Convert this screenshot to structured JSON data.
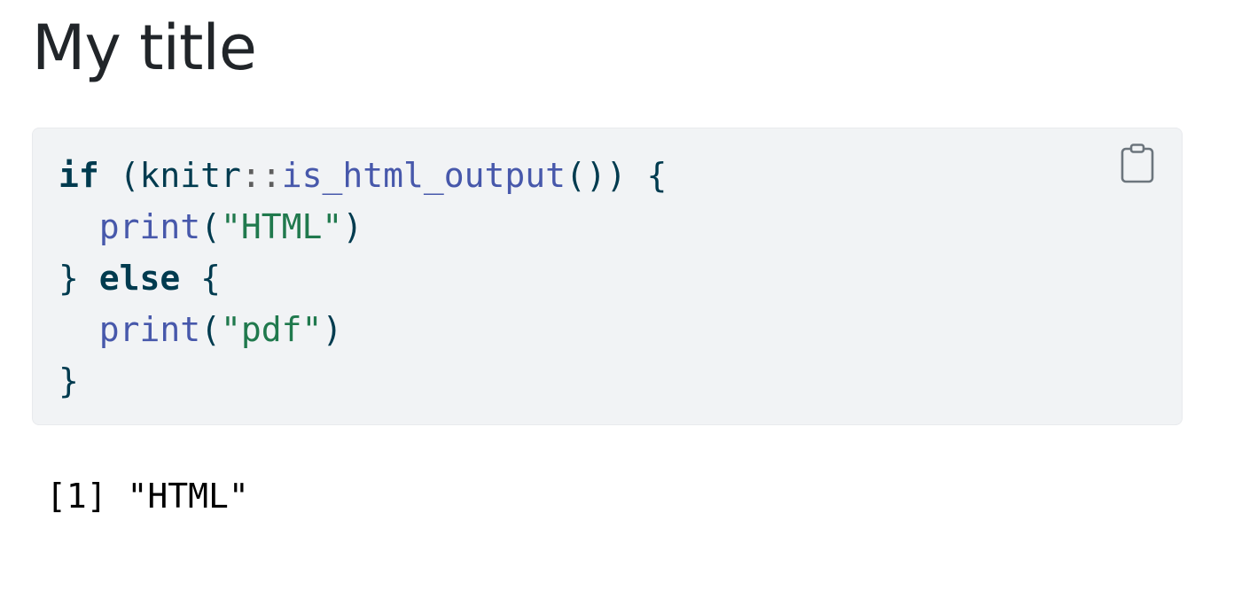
{
  "title": "My title",
  "code_block": {
    "lines": [
      [
        {
          "t": "kw",
          "v": "if"
        },
        {
          "t": "plain",
          "v": " (knitr"
        },
        {
          "t": "ns",
          "v": "::"
        },
        {
          "t": "fn",
          "v": "is_html_output"
        },
        {
          "t": "plain",
          "v": "()) {"
        }
      ],
      [
        {
          "t": "plain",
          "v": "  "
        },
        {
          "t": "fn",
          "v": "print"
        },
        {
          "t": "plain",
          "v": "("
        },
        {
          "t": "str",
          "v": "\"HTML\""
        },
        {
          "t": "plain",
          "v": ")"
        }
      ],
      [
        {
          "t": "plain",
          "v": "} "
        },
        {
          "t": "kw",
          "v": "else"
        },
        {
          "t": "plain",
          "v": " {"
        }
      ],
      [
        {
          "t": "plain",
          "v": "  "
        },
        {
          "t": "fn",
          "v": "print"
        },
        {
          "t": "plain",
          "v": "("
        },
        {
          "t": "str",
          "v": "\"pdf\""
        },
        {
          "t": "plain",
          "v": ")"
        }
      ],
      [
        {
          "t": "plain",
          "v": "}"
        }
      ]
    ],
    "copy_icon": "clipboard-icon"
  },
  "output": "[1] \"HTML\"",
  "colors": {
    "keyword": "#003b4f",
    "function": "#4758ab",
    "string": "#20794d",
    "namespace": "#5e5e5e",
    "code_bg": "#f1f3f5"
  }
}
